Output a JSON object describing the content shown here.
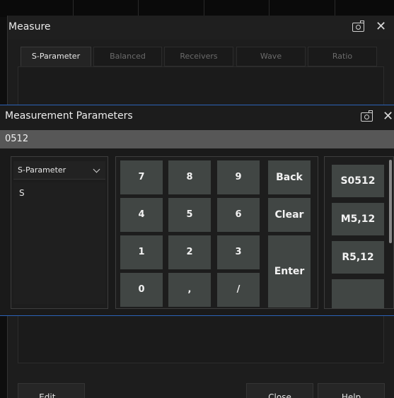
{
  "measure": {
    "title": "Measure",
    "tabs": [
      "S-Parameter",
      "Balanced",
      "Receivers",
      "Wave",
      "Ratio"
    ],
    "buttons": {
      "edit": "Edit...",
      "close": "Close",
      "help": "Help"
    }
  },
  "params": {
    "title": "Measurement Parameters",
    "input_value": "0512",
    "select_value": "S-Parameter",
    "list_items": [
      "S"
    ],
    "keys": [
      "7",
      "8",
      "9",
      "Back",
      "4",
      "5",
      "6",
      "Clear",
      "1",
      "2",
      "3",
      "Enter",
      "0",
      ",",
      "/"
    ],
    "options": [
      "S0512",
      "M5,12",
      "R5,12"
    ]
  },
  "icons": {
    "camera": "camera-icon",
    "close": "close-icon",
    "dropdown": "chevron-down-icon"
  },
  "colors": {
    "dialog_border": "#2c63b8",
    "key_bg": "#414644",
    "input_bg": "#575757"
  }
}
